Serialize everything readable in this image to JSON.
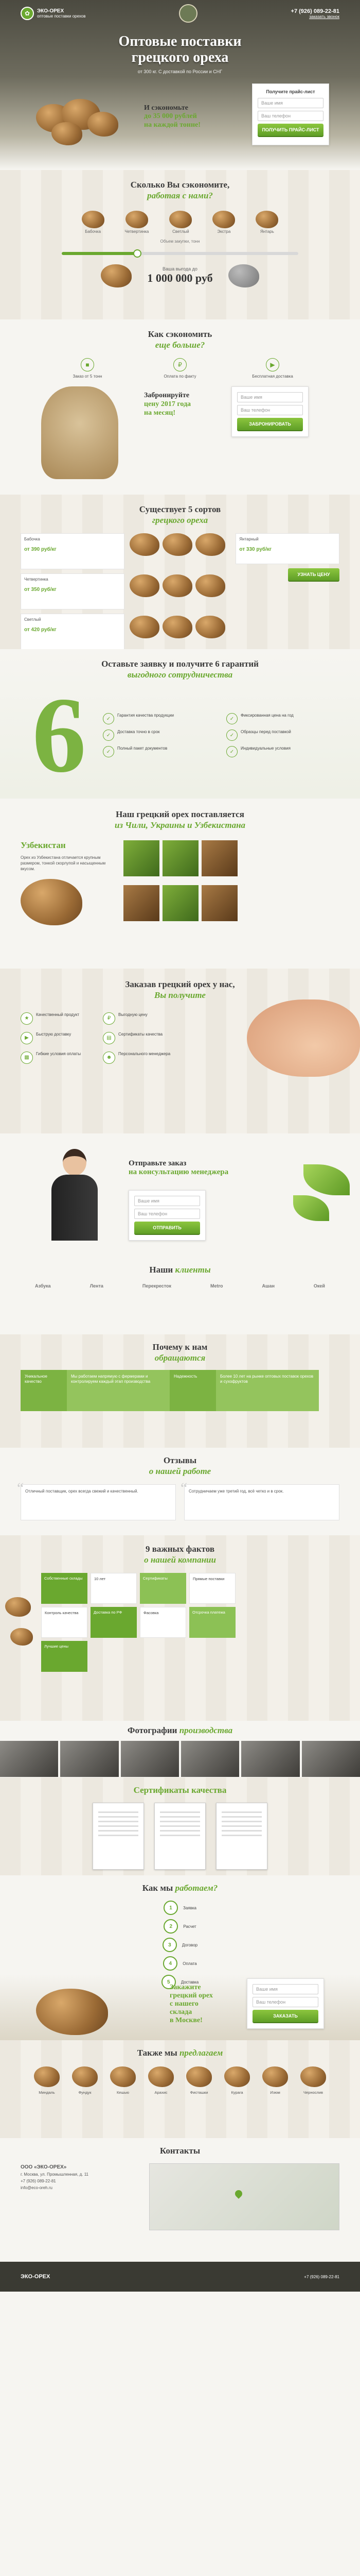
{
  "header": {
    "logo_text": "ЭКО-ОРЕХ",
    "logo_sub": "оптовые поставки орехов",
    "phone": "+7 (926) 089-22-81",
    "callback": "заказать звонок",
    "title_l1": "Оптовые поставки",
    "title_l2": "грецкого ореха",
    "subtitle": "от 300 кг. С доставкой по России и СНГ",
    "offer_l1": "И сэкономьте",
    "offer_l2": "до 35 000 рублей",
    "offer_l3": "на каждой тонне!",
    "form_title": "Получите прайс-лист",
    "form_name": "Ваше имя",
    "form_phone": "Ваш телефон",
    "form_btn": "Получить прайс-лист"
  },
  "calc": {
    "title_l1": "Сколько Вы сэкономите,",
    "title_l2": "работая с нами?",
    "sorts": [
      "Бабочка",
      "Четвертинка",
      "Светлый",
      "Экстра",
      "Янтарь"
    ],
    "volume_label": "Объем закупки, тонн",
    "volume_fraction": 0.32,
    "result_label": "Ваша выгода до",
    "result_sum": "1 000 000 руб"
  },
  "why": {
    "title_l1": "Как сэкономить",
    "title_l2": "еще больше?",
    "items": [
      "Заказ от 5 тонн",
      "Оплата по факту",
      "Бесплатная доставка"
    ],
    "promo_l1": "Забронируйте",
    "promo_l2": "цену 2017 года",
    "promo_l3": "на месяц!",
    "form_name": "Ваше имя",
    "form_phone": "Ваш телефон",
    "form_btn": "Забронировать"
  },
  "sorts": {
    "title_l1": "Существует 5 сортов",
    "title_l2": "грецкого ореха",
    "cards": [
      {
        "name": "Бабочка",
        "price": "от 390 руб/кг"
      },
      {
        "name": "Четвертинка",
        "price": "от 350 руб/кг"
      },
      {
        "name": "Светлый",
        "price": "от 420 руб/кг"
      },
      {
        "name": "Янтарный",
        "price": "от 330 руб/кг"
      }
    ],
    "btn": "Узнать цену"
  },
  "guar": {
    "title_l1": "Оставьте заявку и получите 6 гарантий",
    "title_l2": "выгодного сотрудничества",
    "six": "6",
    "items": [
      "Гарантия качества продукции",
      "Фиксированная цена на год",
      "Доставка точно в срок",
      "Образцы перед поставкой",
      "Полный пакет документов",
      "Индивидуальные условия"
    ]
  },
  "origin": {
    "title_l1": "Наш грецкий орех поставляется",
    "title_l2": "из Чили, Украины и Узбекистана",
    "country": "Узбекистан",
    "desc": "Орех из Узбекистана отличается крупным размером, тонкой скорлупой и насыщенным вкусом."
  },
  "order": {
    "title_l1": "Заказав грецкий орех у нас,",
    "title_l2": "Вы получите",
    "items": [
      "Качественный продукт",
      "Выгодную цену",
      "Быструю доставку",
      "Сертификаты качества",
      "Гибкие условия оплаты",
      "Персонального менеджера"
    ]
  },
  "manager": {
    "bubble_l1": "Отправьте заказ",
    "bubble_l2": "на консультацию менеджера",
    "form_name": "Ваше имя",
    "form_phone": "Ваш телефон",
    "form_btn": "Отправить"
  },
  "clients": {
    "title_l1": "Наши",
    "title_l2": "клиенты",
    "logos": [
      "Азбука",
      "Лента",
      "Перекресток",
      "Metro",
      "Ашан",
      "Окей"
    ]
  },
  "reasons": {
    "title_l1": "Почему к нам",
    "title_l2": "обращаются",
    "cells": [
      "Уникальное качество",
      "Мы работаем напрямую с фермерами и контролируем каждый этап производства",
      "Надежность",
      "Более 10 лет на рынке оптовых поставок орехов и сухофруктов"
    ]
  },
  "reviews": {
    "title_l1": "Отзывы",
    "title_l2": "о нашей работе",
    "items": [
      "Отличный поставщик, орех всегда свежий и качественный.",
      "Сотрудничаем уже третий год, всё четко и в срок."
    ]
  },
  "facts": {
    "title_l1": "9 важных фактов",
    "title_l2": "о нашей компании",
    "cells": [
      "Собственные склады",
      "10 лет",
      "Сертификаты",
      "Прямые поставки",
      "Контроль качества",
      "Доставка по РФ",
      "Фасовка",
      "Отсрочка платежа",
      "Лучшие цены"
    ]
  },
  "gallery": {
    "title_l1": "Фотографии",
    "title_l2": "производства"
  },
  "certs": {
    "title": "Сертификаты качества"
  },
  "steps": {
    "title_l1": "Как мы",
    "title_l2": "работаем?",
    "items": [
      "Заявка",
      "Расчет",
      "Договор",
      "Оплата",
      "Доставка"
    ],
    "cta_l1": "Закажите",
    "cta_l2": "грецкий орех",
    "cta_l3": "с нашего",
    "cta_l4": "склада",
    "cta_l5": "в Москве!",
    "form_name": "Ваше имя",
    "form_phone": "Ваш телефон",
    "form_btn": "Заказать"
  },
  "also": {
    "title_l1": "Также мы",
    "title_l2": "предлагаем",
    "items": [
      "Миндаль",
      "Фундук",
      "Кешью",
      "Арахис",
      "Фисташки",
      "Курага",
      "Изюм",
      "Чернослив"
    ]
  },
  "contacts": {
    "title": "Контакты",
    "company": "ООО «ЭКО-ОРЕХ»",
    "address": "г. Москва, ул. Промышленная, д. 11",
    "phone": "+7 (926) 089-22-81",
    "email": "info@eco-oreh.ru"
  },
  "footer": {
    "logo": "ЭКО-ОРЕХ",
    "phone": "+7 (926) 089-22-81"
  },
  "colors": {
    "accent": "#6aa82f",
    "dark": "#3a3a33"
  }
}
